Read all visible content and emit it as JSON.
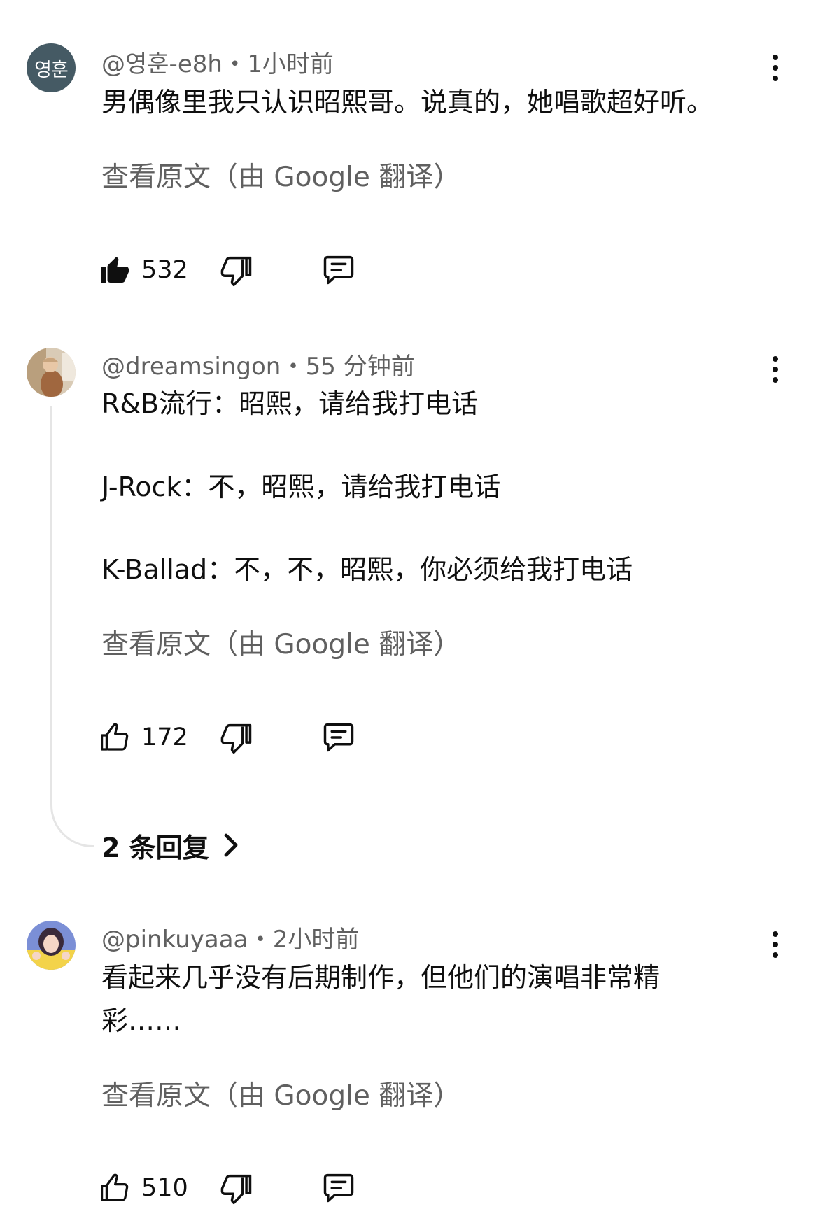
{
  "comments": [
    {
      "avatar_text": "영훈",
      "handle": "@영훈-e8h",
      "time": "1小时前",
      "lines": [
        "男偶像里我只认识昭熙哥。说真的，她唱歌超好听。"
      ],
      "translate_label": "查看原文（由 Google 翻译）",
      "likes": "532",
      "liked": true
    },
    {
      "handle": "@dreamsingon",
      "time": "55 分钟前",
      "lines": [
        "R&B流行：昭熙，请给我打电话",
        "J-Rock：不，昭熙，请给我打电话",
        "K-Ballad：不，不，昭熙，你必须给我打电话"
      ],
      "translate_label": "查看原文（由 Google 翻译）",
      "likes": "172",
      "liked": false,
      "replies_label": "2 条回复"
    },
    {
      "handle": "@pinkuyaaa",
      "time": "2小时前",
      "lines": [
        "看起来几乎没有后期制作，但他们的演唱非常精",
        "彩……"
      ],
      "translate_label": "查看原文（由 Google 翻译）",
      "likes": "510",
      "liked": false
    }
  ],
  "colors": {
    "text": "#0f0f0f",
    "secondary": "#606060",
    "avatar_bg": "#455a64",
    "thread_line": "#e5e5e5"
  },
  "icons": [
    "more-vert-icon",
    "thumb-up-icon",
    "thumb-down-icon",
    "reply-icon",
    "chevron-right-icon"
  ]
}
